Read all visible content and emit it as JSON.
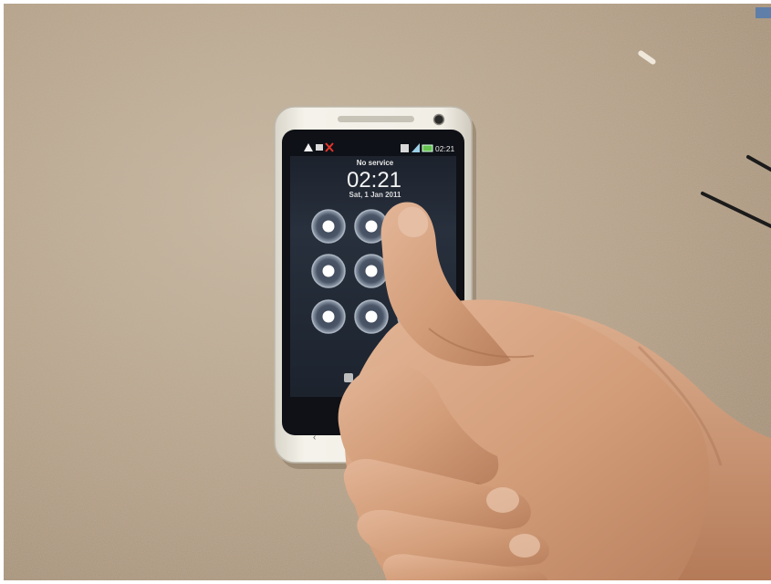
{
  "photo": {
    "description_free": true,
    "surface_color": "#b7a48c",
    "phone_body_color": "#f2efe6",
    "screen_color": "#1f2733",
    "skin_color": "#d7a684"
  },
  "lockscreen": {
    "status_time": "02:21",
    "carrier": "No service",
    "clock": "02:21",
    "date": "Sat, 1 Jan 2011"
  },
  "pattern_grid": {
    "rows": 3,
    "cols": 3,
    "dot_color": "#ffffff",
    "ring_color": "#aab4c0"
  }
}
